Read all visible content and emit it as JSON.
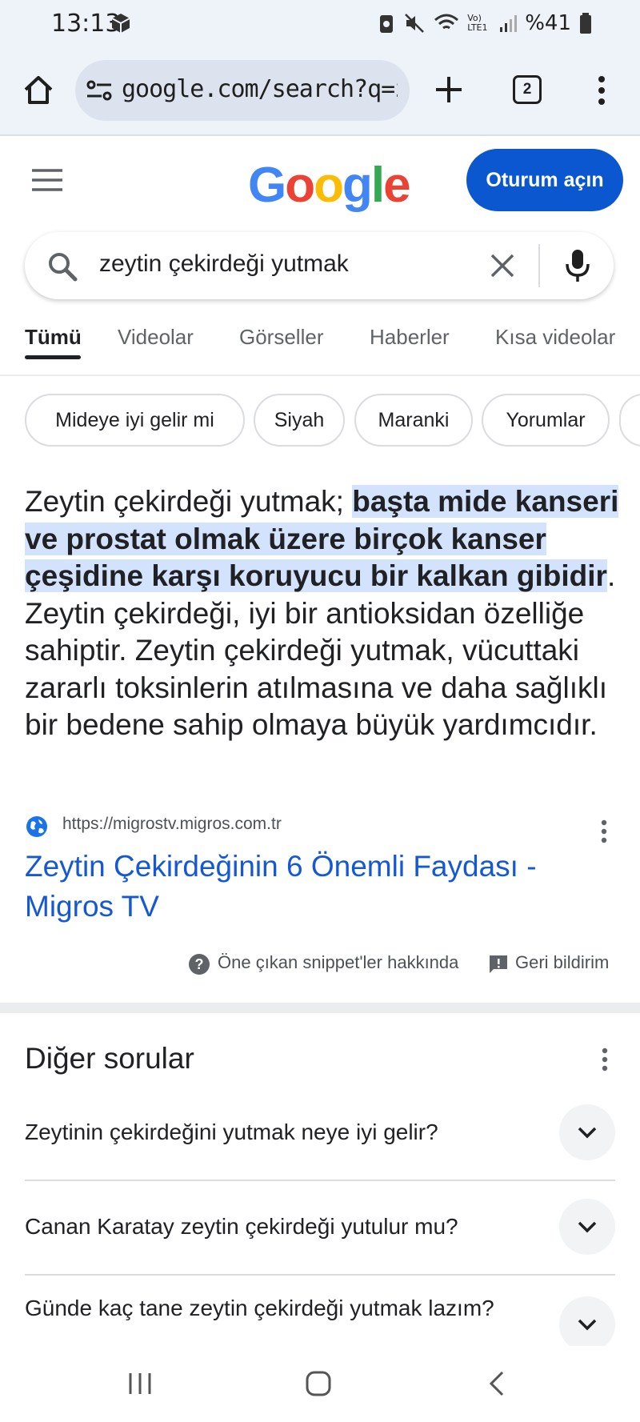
{
  "status_bar": {
    "time": "13:13",
    "battery": "%41",
    "network": "Vo) LTE1"
  },
  "browser": {
    "url": "google.com/search?q=zey",
    "tab_count": "2"
  },
  "header": {
    "logo_letters": [
      {
        "char": "G",
        "color": "#4285F4"
      },
      {
        "char": "o",
        "color": "#EA4335"
      },
      {
        "char": "o",
        "color": "#FBBC05"
      },
      {
        "char": "g",
        "color": "#4285F4"
      },
      {
        "char": "l",
        "color": "#34A853"
      },
      {
        "char": "e",
        "color": "#EA4335"
      }
    ],
    "signin_label": "Oturum açın"
  },
  "search": {
    "query": "zeytin çekirdeği yutmak"
  },
  "tabs": [
    "Tümü",
    "Videolar",
    "Görseller",
    "Haberler",
    "Kısa videolar"
  ],
  "chips": [
    "Mideye iyi gelir mi",
    "Siyah",
    "Maranki",
    "Yorumlar"
  ],
  "snippet": {
    "lead": "Zeytin çekirdeği yutmak; ",
    "highlight": "başta mide kanseri ve prostat olmak üzere birçok kanser çeşidine karşı koruyucu bir kalkan gibidir",
    "rest": ". Zeytin çekirdeği, iyi bir antioksidan özelliğe sahiptir. Zeytin çekirdeği yutmak, vücuttaki zararlı toksinlerin atılmasına ve daha sağlıklı bir bedene sahip olmaya büyük yardımcıdır.",
    "source_url": "https://migrostv.migros.com.tr",
    "title": "Zeytin Çekirdeğinin 6 Önemli Faydası - Migros TV",
    "about_label": "Öne çıkan snippet'ler hakkında",
    "feedback_label": "Geri bildirim"
  },
  "other_questions": {
    "title": "Diğer sorular",
    "items": [
      "Zeytinin çekirdeğini yutmak neye iyi gelir?",
      "Canan Karatay zeytin çekirdeği yutulur mu?",
      "Günde kaç tane zeytin çekirdeği yutmak lazım?"
    ]
  },
  "colors": {
    "accent": "#0b57d0",
    "link": "#1558d6",
    "highlight": "#d3e3fd"
  }
}
